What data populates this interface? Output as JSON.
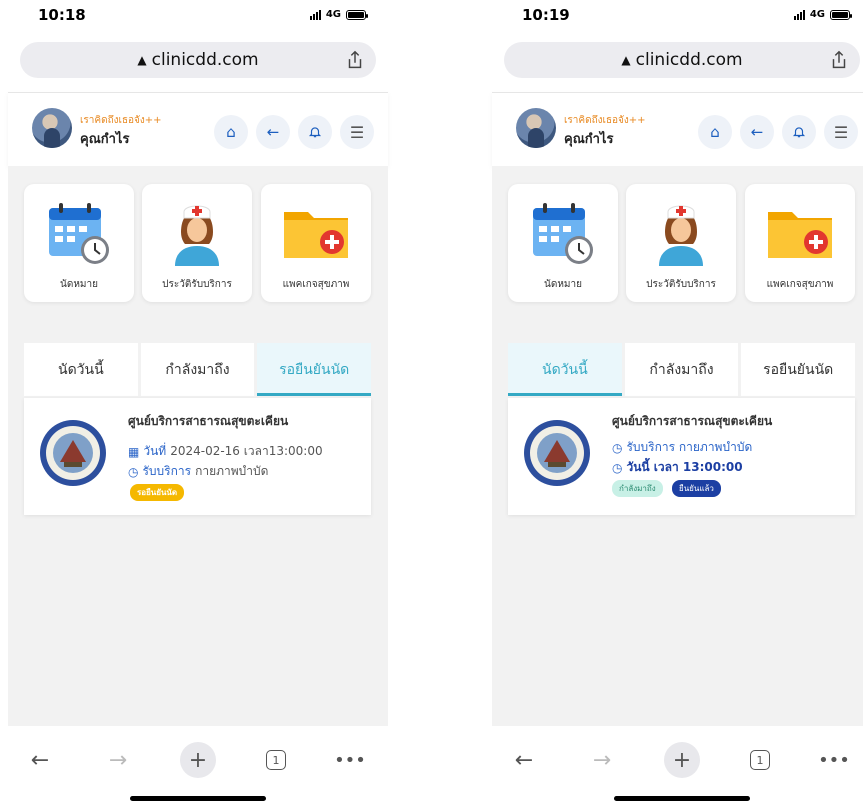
{
  "left": {
    "status": {
      "time": "10:18",
      "network": "4G"
    },
    "browser": {
      "url": "clinicdd.com",
      "tab_count": "1"
    },
    "user": {
      "subtitle": "เราคิดถึงเธอจัง++",
      "name": "คุณกำไร"
    },
    "menu": [
      "นัดหมาย",
      "ประวัติรับบริการ",
      "แพคเกจสุขภาพ"
    ],
    "tabs": [
      "นัดวันนี้",
      "กำลังมาถึง",
      "รอยืนยันนัด"
    ],
    "active_tab": 2,
    "appointment": {
      "clinic": "ศูนย์บริการสาธารณสุขตะเคียน",
      "date_label": "วันที่",
      "date_value": "2024-02-16 เวลา13:00:00",
      "service_label": "รับบริการ",
      "service_value": "กายภาพบำบัด",
      "status_badge": "รอยืนยันนัด"
    }
  },
  "right": {
    "status": {
      "time": "10:19",
      "network": "4G"
    },
    "browser": {
      "url": "clinicdd.com",
      "tab_count": "1"
    },
    "user": {
      "subtitle": "เราคิดถึงเธอจัง++",
      "name": "คุณกำไร"
    },
    "menu": [
      "นัดหมาย",
      "ประวัติรับบริการ",
      "แพคเกจสุขภาพ"
    ],
    "tabs": [
      "นัดวันนี้",
      "กำลังมาถึง",
      "รอยืนยันนัด"
    ],
    "active_tab": 0,
    "appointment": {
      "clinic": "ศูนย์บริการสาธารณสุขตะเคียน",
      "service_line": "รับบริการ กายภาพบำบัด",
      "time_line": "วันนี้ เวลา 13:00:00",
      "badge_upcoming": "กำลังมาถึง",
      "badge_confirmed": "ยืนยันแล้ว"
    }
  },
  "colors": {
    "accent": "#34a9c4",
    "link_blue": "#2a64c8",
    "pending_yellow": "#f5b800",
    "confirmed_navy": "#1c3fa3",
    "upcoming_mint": "#c8f0e6",
    "greeting_orange": "#e88a23"
  }
}
